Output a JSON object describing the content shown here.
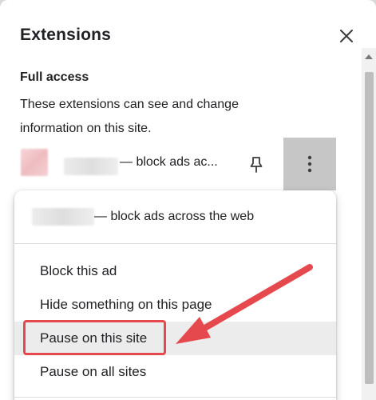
{
  "panel": {
    "title": "Extensions",
    "close_icon": "close-icon"
  },
  "access": {
    "heading": "Full access",
    "description": "These extensions can see and change information on this site."
  },
  "extension": {
    "name_suffix": "— block ads ac...",
    "pin_icon": "pin-icon",
    "more_icon": "more-vertical-icon"
  },
  "menu": {
    "header_suffix": "— block ads across the web",
    "items": [
      {
        "label": "Block this ad"
      },
      {
        "label": "Hide something on this page"
      },
      {
        "label": "Pause on this site"
      },
      {
        "label": "Pause on all sites"
      }
    ]
  },
  "colors": {
    "annotation": "#e5484d",
    "hover": "#ececec",
    "more_button": "#c6c6c6"
  }
}
